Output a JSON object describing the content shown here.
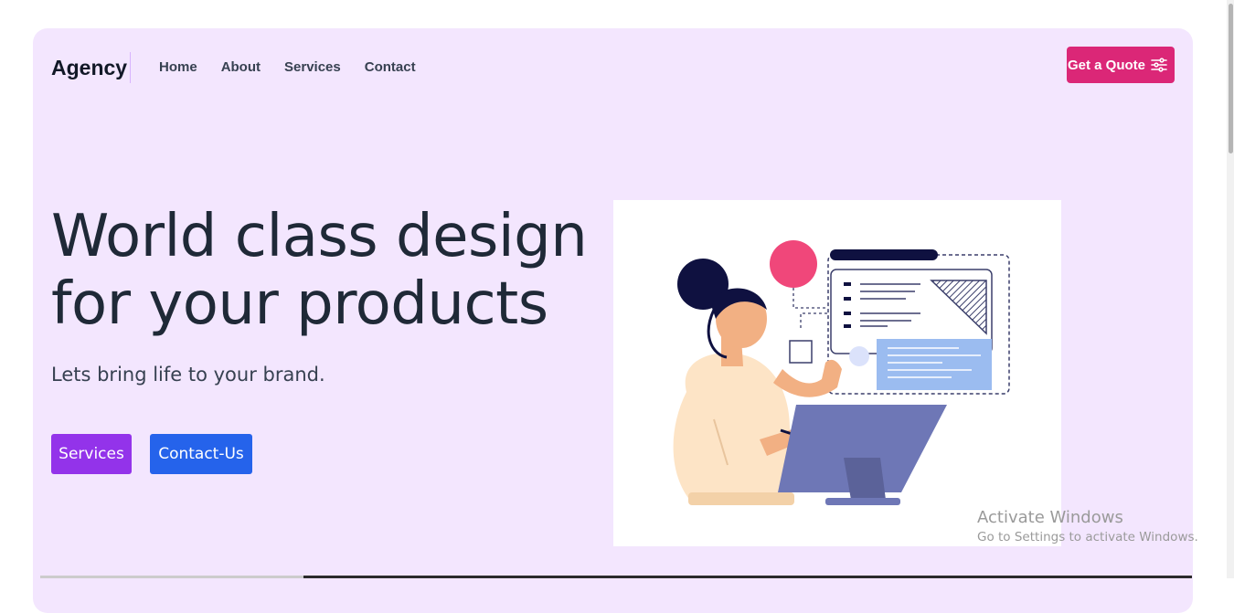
{
  "header": {
    "brand": "Agency",
    "nav": [
      "Home",
      "About",
      "Services",
      "Contact"
    ],
    "cta_label": "Get a Quote"
  },
  "hero": {
    "headline_line1": "World class design",
    "headline_line2": "for your products",
    "subtitle": "Lets bring life to your brand.",
    "buttons": [
      "Services",
      "Contact-Us"
    ]
  },
  "overlay": {
    "activate_title": "Activate Windows",
    "activate_subtitle": "Go to Settings to activate Windows."
  },
  "colors": {
    "card_bg": "#f3e6fe",
    "cta": "#db2777",
    "services_btn": "#9333ea",
    "contact_btn": "#2563eb"
  },
  "icons": [
    "sliders-icon"
  ]
}
